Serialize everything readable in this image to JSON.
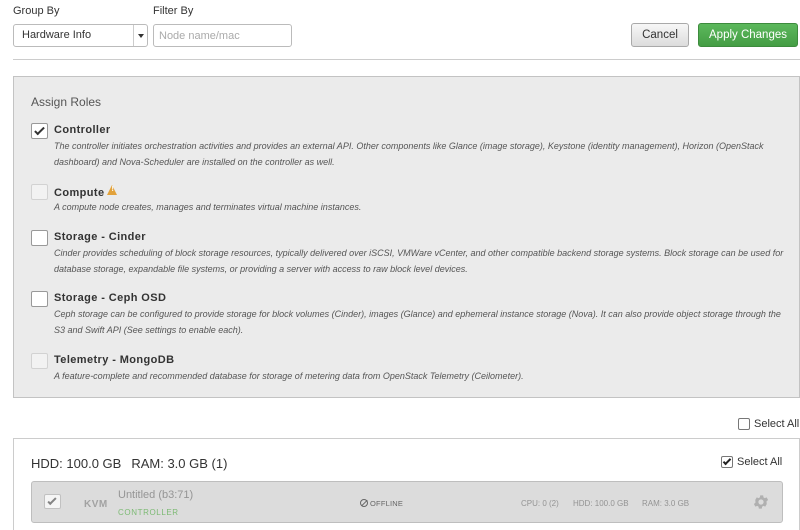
{
  "toolbar": {
    "group_by_label": "Group By",
    "group_by_value": "Hardware Info",
    "filter_by_label": "Filter By",
    "filter_placeholder": "Node name/mac",
    "cancel_label": "Cancel",
    "apply_label": "Apply Changes"
  },
  "roles": {
    "title": "Assign Roles",
    "items": [
      {
        "name": "Controller",
        "checked": true,
        "disabled": false,
        "description": "The controller initiates orchestration activities and provides an external API. Other components like Glance (image storage), Keystone (identity management), Horizon (OpenStack dashboard) and Nova-Scheduler are installed on the controller as well."
      },
      {
        "name": "Compute",
        "checked": false,
        "disabled": true,
        "warning_icon": "warning-icon",
        "description": "A compute node creates, manages and terminates virtual machine instances."
      },
      {
        "name": "Storage - Cinder",
        "checked": false,
        "disabled": false,
        "description": "Cinder provides scheduling of block storage resources, typically delivered over iSCSI, VMWare vCenter, and other compatible backend storage systems. Block storage can be used for database storage, expandable file systems, or providing a server with access to raw block level devices."
      },
      {
        "name": "Storage - Ceph OSD",
        "checked": false,
        "disabled": false,
        "description": "Ceph storage can be configured to provide storage for block volumes (Cinder), images (Glance) and ephemeral instance storage (Nova). It can also provide object storage through the S3 and Swift API (See settings to enable each)."
      },
      {
        "name": "Telemetry - MongoDB",
        "checked": false,
        "disabled": true,
        "description": "A feature-complete and recommended database for storage of metering data from OpenStack Telemetry (Ceilometer)."
      }
    ]
  },
  "select_all_global": {
    "label": "Select All",
    "checked": false
  },
  "node_group": {
    "hdd": "HDD: 100.0 GB",
    "ram": "RAM: 3.0 GB (1)",
    "select_all_label": "Select All",
    "select_all_checked": true,
    "nodes": [
      {
        "type": "KVM",
        "name": "Untitled (b3:71)",
        "role": "CONTROLLER",
        "status": "OFFLINE",
        "cpu": "CPU: 0 (2)",
        "hdd": "HDD: 100.0 GB",
        "ram": "RAM: 3.0 GB",
        "checked": true
      }
    ]
  }
}
